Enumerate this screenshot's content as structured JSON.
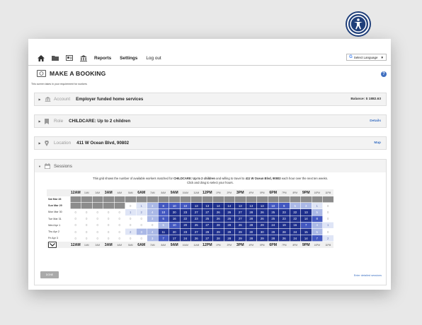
{
  "topbar": {
    "icons": [
      "home-icon",
      "folder-icon",
      "id-card-icon",
      "bank-icon"
    ],
    "nav": [
      "Reports",
      "Settings",
      "Log out"
    ],
    "language": "Select Language",
    "language_g": "G",
    "language_caret": "▼"
  },
  "page": {
    "title": "MAKE A BOOKING",
    "subtitle": "This screen takes in your requirement for workers",
    "help": "?"
  },
  "account": {
    "label": "Account",
    "value": "Employer funded home services",
    "right": "Balance: $ 1882.63"
  },
  "role": {
    "label": "Role",
    "value": "CHILDCARE: Up to 2 children",
    "right": "Details"
  },
  "location": {
    "label": "Location",
    "value": "411 W Ocean Blvd, 90802",
    "right": "Map"
  },
  "sessions": {
    "label": "Sessions",
    "desc_1": "This grid shows the number of available workers matched for ",
    "desc_role": "CHILDCARE: Up to 2 children",
    "desc_2": " and willing to travel to ",
    "desc_loc": "411 W Ocean Blvd, 90802",
    "desc_3": " each hour over the next ten weeks.",
    "desc_line2": "Click and drag to select your hours.",
    "hours": [
      "12AM",
      "1AM",
      "2AM",
      "3AM",
      "4AM",
      "5AM",
      "6AM",
      "7AM",
      "8AM",
      "9AM",
      "10AM",
      "11AM",
      "12PM",
      "1PM",
      "2PM",
      "3PM",
      "4PM",
      "5PM",
      "6PM",
      "7PM",
      "8PM",
      "9PM",
      "10PM",
      "11PM"
    ],
    "big_hours": [
      "12AM",
      "3AM",
      "6AM",
      "9AM",
      "12PM",
      "3PM",
      "6PM",
      "9PM"
    ],
    "rows": [
      {
        "day": "Sat Mar 28",
        "bold": true,
        "values": [
          "",
          "",
          "",
          "",
          "",
          "",
          "",
          "",
          "",
          "",
          "",
          "",
          "",
          "",
          "",
          "",
          "",
          "",
          "",
          "",
          "",
          "",
          "",
          ""
        ]
      },
      {
        "day": "Sun Mar 29",
        "bold": true,
        "values": [
          "",
          "",
          "",
          "",
          "",
          "0",
          "1",
          "3",
          "8",
          "10",
          "10",
          "13",
          "13",
          "14",
          "14",
          "13",
          "13",
          "13",
          "10",
          "9",
          "5",
          "3",
          "1",
          "0"
        ]
      },
      {
        "day": "Mon Mar 30",
        "bold": false,
        "values": [
          "0",
          "0",
          "0",
          "0",
          "0",
          "1",
          "2",
          "4",
          "10",
          "20",
          "23",
          "27",
          "27",
          "26",
          "26",
          "27",
          "28",
          "26",
          "25",
          "23",
          "22",
          "13",
          "5",
          "0"
        ]
      },
      {
        "day": "Tue Mar 31",
        "bold": false,
        "values": [
          "0",
          "0",
          "0",
          "0",
          "0",
          "0",
          "0",
          "3",
          "6",
          "16",
          "22",
          "23",
          "25",
          "26",
          "26",
          "27",
          "28",
          "26",
          "25",
          "23",
          "22",
          "14",
          "8",
          "0"
        ]
      },
      {
        "day": "Wed Apr 1",
        "bold": false,
        "values": [
          "0",
          "0",
          "0",
          "0",
          "0",
          "0",
          "0",
          "0",
          "5",
          "10",
          "20",
          "25",
          "27",
          "28",
          "28",
          "26",
          "28",
          "29",
          "24",
          "19",
          "16",
          "7",
          "4",
          "1"
        ]
      },
      {
        "day": "Thu Apr 2",
        "bold": false,
        "values": [
          "0",
          "0",
          "0",
          "0",
          "0",
          "2",
          "3",
          "4",
          "11",
          "20",
          "23",
          "27",
          "29",
          "29",
          "29",
          "29",
          "30",
          "30",
          "29",
          "28",
          "24",
          "15",
          "5",
          "0"
        ]
      },
      {
        "day": "Fri Apr 3",
        "bold": false,
        "values": [
          "0",
          "0",
          "0",
          "0",
          "0",
          "0",
          "0",
          "3",
          "7",
          "17",
          "24",
          "26",
          "27",
          "28",
          "28",
          "29",
          "28",
          "29",
          "28",
          "26",
          "24",
          "14",
          "7",
          "2"
        ]
      }
    ],
    "done": "DONE",
    "enter": "Enter detailed sessions"
  },
  "colors": {
    "dark": "#1e2f8c",
    "mid": "#4358c0",
    "light": "#aab8e6",
    "pale": "#dfe5f6",
    "zero": "#ffffff",
    "past": "#8c8c8c"
  }
}
